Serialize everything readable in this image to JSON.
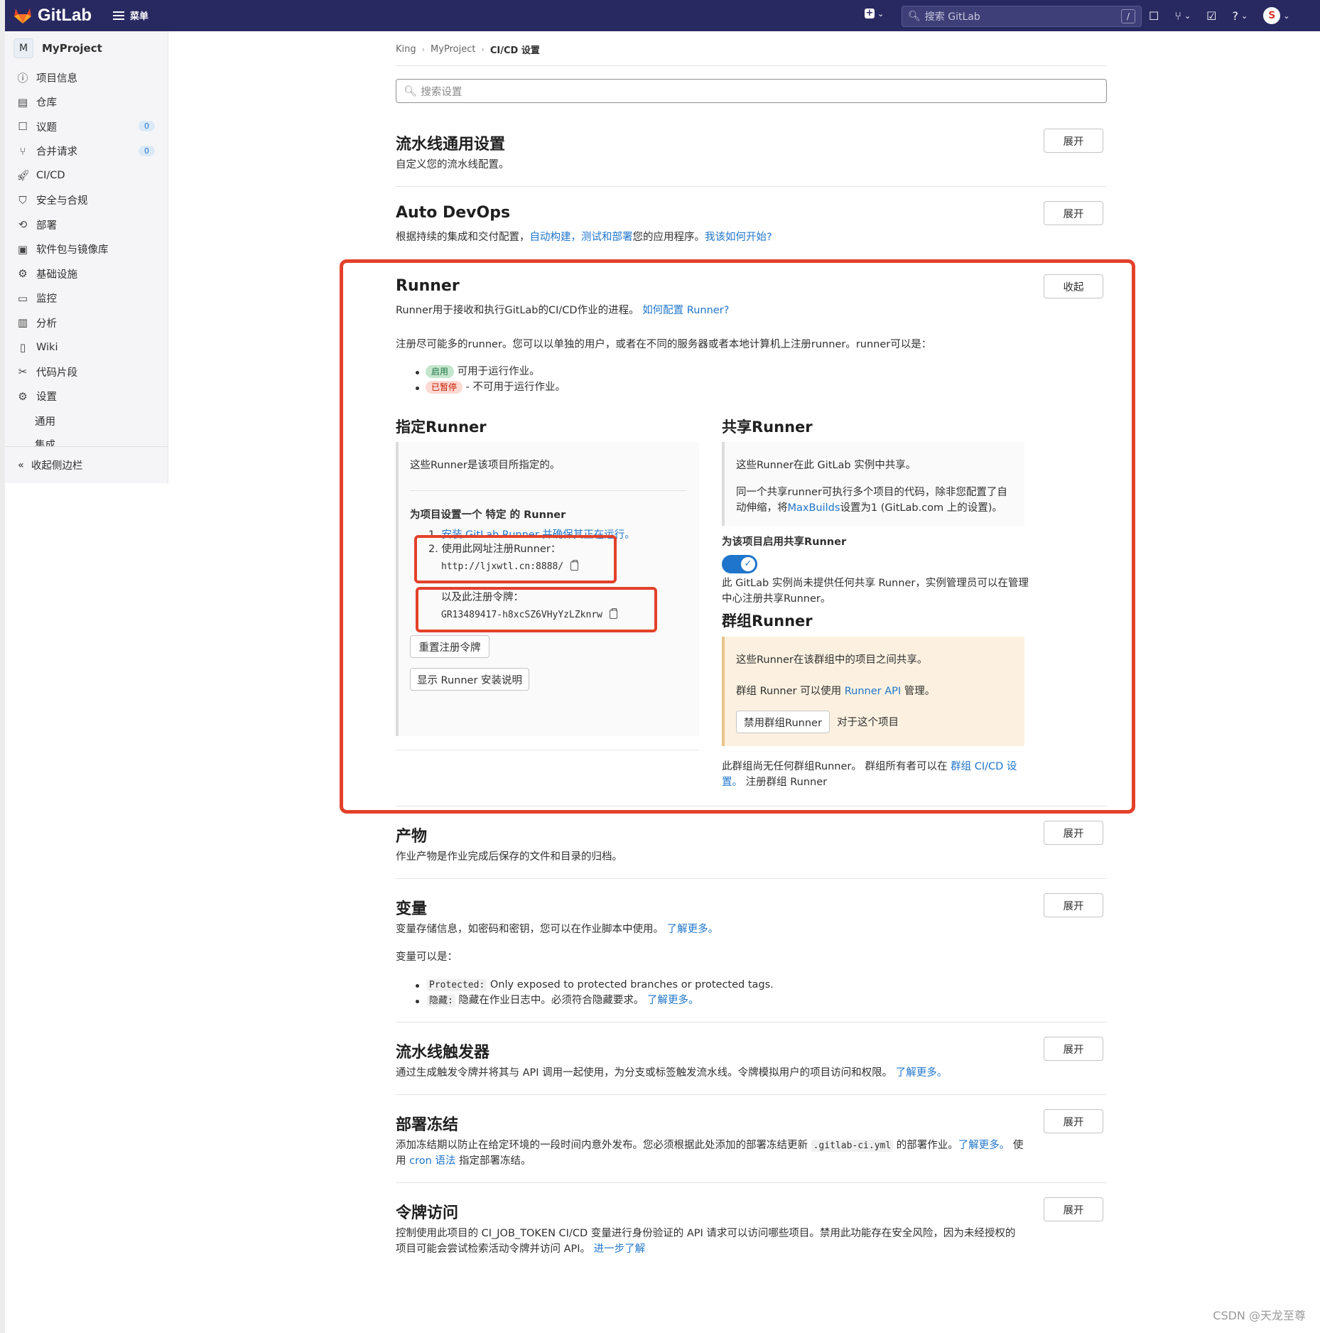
{
  "topbar": {
    "brand": "GitLab",
    "menu_label": "菜单",
    "search_placeholder": "搜索 GitLab",
    "search_shortcut": "/",
    "brand_color": "#292961"
  },
  "sidebar": {
    "project_initial": "M",
    "project_name": "MyProject",
    "items": [
      {
        "label": "项目信息",
        "icon": "info-icon"
      },
      {
        "label": "仓库",
        "icon": "document-icon"
      },
      {
        "label": "议题",
        "icon": "issues-icon",
        "badge": "0"
      },
      {
        "label": "合并请求",
        "icon": "merge-request-icon",
        "badge": "0"
      },
      {
        "label": "CI/CD",
        "icon": "rocket-icon"
      },
      {
        "label": "安全与合规",
        "icon": "shield-icon"
      },
      {
        "label": "部署",
        "icon": "deployments-icon"
      },
      {
        "label": "软件包与镜像库",
        "icon": "package-icon"
      },
      {
        "label": "基础设施",
        "icon": "cloud-gear-icon"
      },
      {
        "label": "监控",
        "icon": "monitor-icon"
      },
      {
        "label": "分析",
        "icon": "chart-icon"
      },
      {
        "label": "Wiki",
        "icon": "book-icon"
      },
      {
        "label": "代码片段",
        "icon": "scissors-icon"
      },
      {
        "label": "设置",
        "icon": "gear-icon"
      }
    ],
    "sub_items": [
      "通用",
      "集成"
    ],
    "collapse_label": "收起侧边栏"
  },
  "breadcrumb": [
    "King",
    "MyProject",
    "CI/CD 设置"
  ],
  "search_settings_placeholder": "搜索设置",
  "sections": {
    "pipeline": {
      "title": "流水线通用设置",
      "desc": "自定义您的流水线配置。",
      "button": "展开"
    },
    "autodevops": {
      "title": "Auto DevOps",
      "desc_prefix": "根据持续的集成和交付配置，",
      "desc_link": "自动构建，测试和部署",
      "desc_mid": "您的应用程序。",
      "desc_link2": "我该如何开始?",
      "button": "展开"
    },
    "runner": {
      "title": "Runner",
      "desc_prefix": "Runner用于接收和执行GitLab的CI/CD作业的进程。 ",
      "desc_link": "如何配置 Runner?",
      "button": "收起",
      "register_text": "注册尽可能多的runner。您可以以单独的用户，或者在不同的服务器或者本地计算机上注册runner。runner可以是：",
      "bullet1_pill": "启用",
      "bullet1_text": "可用于运行作业。",
      "bullet2_pill": "已暂停",
      "bullet2_text": "- 不可用于运行作业。",
      "specific": {
        "title": "指定Runner",
        "desc": "这些Runner是该项目所指定的。",
        "setup_title": "为项目设置一个 特定 的 Runner",
        "step1_prefix": "1. ",
        "step1_link": "安装 GitLab Runner 并确保其正在运行。",
        "step2_label": "2. 使用此网址注册Runner：",
        "url": "http://ljxwtl.cn:8888/",
        "token_label": "以及此注册令牌：",
        "token": "GR13489417-h8xcSZ6VHyYzLZknrw",
        "reset_button": "重置注册令牌",
        "show_button": "显示 Runner 安装说明"
      },
      "shared": {
        "title": "共享Runner",
        "desc1": "这些Runner在此 GitLab 实例中共享。",
        "desc2_line1": "同一个共享runner可执行多个项目的代码，除非您配置了自",
        "desc2_prefix": "动伸缩，将",
        "desc2_link": "MaxBuilds",
        "desc2_suffix": "设置为1 (GitLab.com 上的设置)。",
        "enable_label": "为该项目启用共享Runner",
        "toggle_on": true,
        "note_line1": "此 GitLab 实例尚未提供任何共享 Runner，实例管理员可以在管理",
        "note_line2": "中心注册共享Runner。"
      },
      "group": {
        "title": "群组Runner",
        "desc1": "这些Runner在该群组中的项目之间共享。",
        "desc2_prefix": "群组 Runner 可以使用 ",
        "desc2_link": "Runner API",
        "desc2_suffix": " 管理。",
        "disable_button": "禁用群组Runner",
        "disable_suffix": "对于这个项目",
        "note_prefix": "此群组尚无任何群组Runner。 群组所有者可以在 ",
        "note_link1": "群组 CI/CD 设",
        "note_link2": "置。",
        "note_suffix": " 注册群组 Runner"
      }
    },
    "artifacts": {
      "title": "产物",
      "desc": "作业产物是作业完成后保存的文件和目录的归档。",
      "button": "展开"
    },
    "variables": {
      "title": "变量",
      "desc_prefix": "变量存储信息，如密码和密钥，您可以在作业脚本中使用。 ",
      "desc_link": "了解更多。",
      "can_be": "变量可以是：",
      "b1_code": "Protected:",
      "b1_text": " Only exposed to protected branches or protected tags.",
      "b2_code": "隐藏:",
      "b2_text": " 隐藏在作业日志中。必须符合隐藏要求。 ",
      "b2_link": "了解更多。",
      "button": "展开"
    },
    "triggers": {
      "title": "流水线触发器",
      "desc_prefix": "通过生成触发令牌并将其与 API 调用一起使用，为分支或标签触发流水线。令牌模拟用户的项目访问和权限。 ",
      "desc_link": "了解更多。",
      "button": "展开"
    },
    "freeze": {
      "title": "部署冻结",
      "line1_prefix": "添加冻结期以防止在给定环境的一段时间内意外发布。您必须根据此处添加的部署冻结更新 ",
      "line1_code": ".gitlab-ci.yml",
      "line1_mid": " 的部署作业。",
      "line1_link": "了解更多。",
      "line1_suffix": " 使",
      "line2_prefix": "用 ",
      "line2_link": "cron 语法",
      "line2_suffix": " 指定部署冻结。",
      "button": "展开"
    },
    "token": {
      "title": "令牌访问",
      "line1": "控制使用此项目的 CI_JOB_TOKEN CI/CD 变量进行身份验证的 API 请求可以访问哪些项目。禁用此功能存在安全风险，因为未经授权的",
      "line2_prefix": "项目可能会尝试检索活动令牌并访问 API。 ",
      "line2_link": "进一步了解",
      "button": "展开"
    }
  },
  "watermark": "CSDN @天龙至尊",
  "colors": {
    "link": "#1f75cb",
    "highlight": "#e3412a",
    "toggle": "#1f75cb"
  }
}
